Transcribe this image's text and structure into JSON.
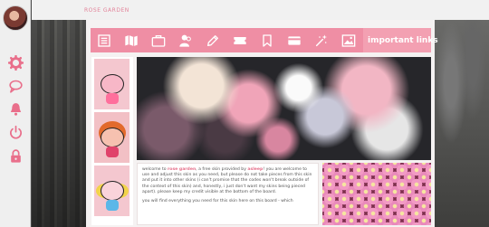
{
  "site": {
    "title": "ROSE GARDEN"
  },
  "sidebar": {
    "icons": [
      "gear-icon",
      "chat-bubble-icon",
      "bell-icon",
      "power-icon",
      "lock-icon"
    ]
  },
  "nav": {
    "icons": [
      "list-icon",
      "map-icon",
      "briefcase-icon",
      "users-icon",
      "pencil-icon",
      "ticket-icon",
      "bookmark-icon",
      "card-icon",
      "sparkle-pen-icon",
      "image-icon"
    ],
    "important_links": "important links"
  },
  "content": {
    "intro_prefix": "welcome to ",
    "intro_name": "rose garden",
    "intro_mid": ", a free skin provided by ",
    "intro_author": "asleep",
    "intro_rest": "! you are welcome to use and adjust this skin as you need, but please do not take pieces from this skin and put it into other skins (i can't promise that the codes won't break outside of the context of this skin) and, honestly, i just don't want my skins being pieced apart). please keep my credit visible at the bottom of the board.",
    "second_line": "you will find everything you need for this skin here on this board - which"
  },
  "colors": {
    "accent_pink": "#ef8ea4",
    "sidebar_icon_pink": "#e96f8b",
    "highlight_text": "#e56f8a"
  }
}
